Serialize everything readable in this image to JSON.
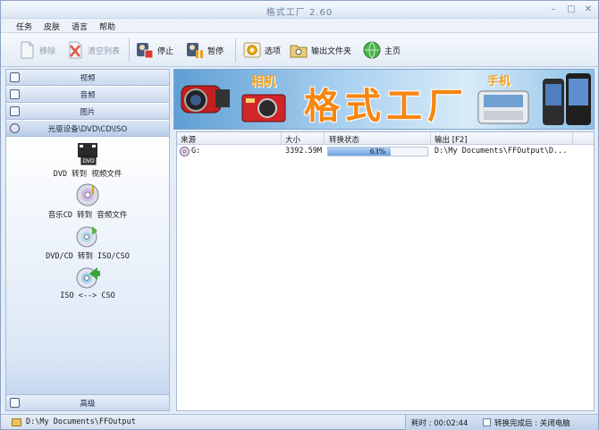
{
  "window": {
    "title": "格式工厂 2.60"
  },
  "menu": [
    "任务",
    "皮肤",
    "语言",
    "帮助"
  ],
  "toolbar": {
    "remove": "移除",
    "clear_list": "清空列表",
    "stop": "停止",
    "pause": "暂停",
    "options": "选项",
    "output_folder": "输出文件夹",
    "home": "主页"
  },
  "sidebar": {
    "categories": [
      "视频",
      "音频",
      "图片",
      "光驱设备\\DVD\\CD\\ISO"
    ],
    "tools": [
      "DVD 转到 视频文件",
      "音乐CD 转到 音频文件",
      "DVD/CD 转到 ISO/CSO",
      "ISO <--> CSO"
    ],
    "advanced": "高级"
  },
  "banner": {
    "title": "格式工厂",
    "camera_label": "相机",
    "phone_label": "手机"
  },
  "grid": {
    "headers": [
      "来源",
      "大小",
      "转换状态",
      "输出 [F2]"
    ],
    "rows": [
      {
        "source": "G:",
        "size": "3392.59M",
        "progress": 63,
        "progress_text": "63%",
        "output": "D:\\My Documents\\FFOutput\\D..."
      }
    ]
  },
  "status": {
    "path": "D:\\My Documents\\FFOutput",
    "elapsed": "耗时 : 00:02:44",
    "after_done": "转换完成后 : 关闭电脑"
  },
  "colors": {
    "accent": "#f6860f",
    "progress": "#6ea2de"
  }
}
